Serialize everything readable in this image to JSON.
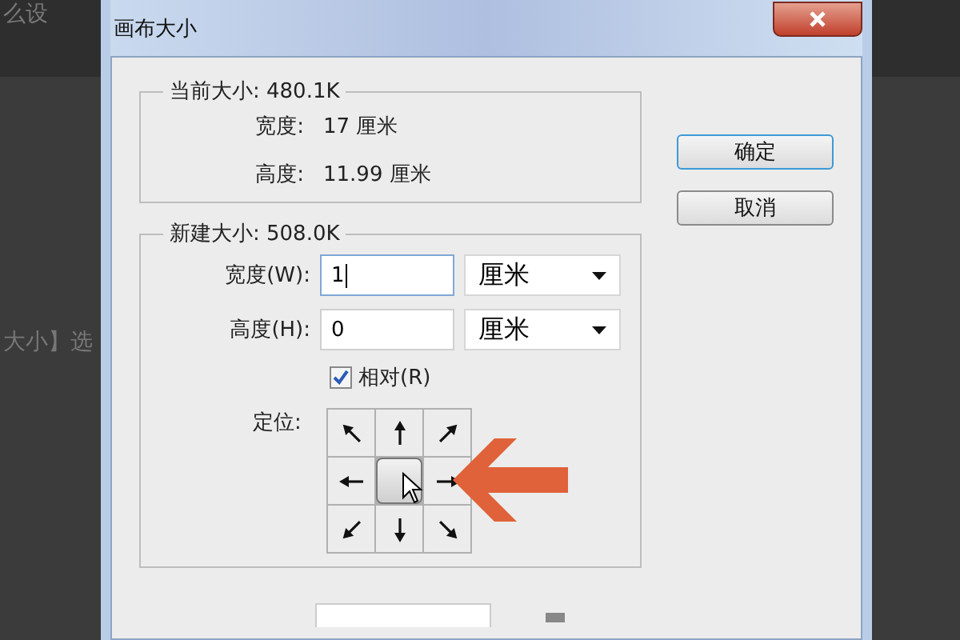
{
  "background": {
    "fragments": [
      "么设",
      "大小】选"
    ]
  },
  "dialog": {
    "title": "画布大小",
    "current_size": {
      "label": "当前大小: 480.1K",
      "rows": [
        {
          "label": "宽度:",
          "value": "17 厘米"
        },
        {
          "label": "高度:",
          "value": "11.99 厘米"
        }
      ]
    },
    "new_size": {
      "label": "新建大小: 508.0K",
      "fields": [
        {
          "label": "宽度(W):",
          "value": "1",
          "unit": "厘米",
          "focused": true
        },
        {
          "label": "高度(H):",
          "value": "0",
          "unit": "厘米",
          "focused": false
        }
      ],
      "relative": {
        "label": "相对(R)",
        "checked": true
      },
      "anchor": {
        "label": "定位:",
        "cells": [
          {
            "selected": false
          },
          {
            "selected": false
          },
          {
            "selected": false
          },
          {
            "selected": false
          },
          {
            "selected": true
          },
          {
            "selected": false
          },
          {
            "selected": false
          },
          {
            "selected": false
          },
          {
            "selected": false
          }
        ]
      }
    },
    "buttons": [
      {
        "label": "确定",
        "default": true
      },
      {
        "label": "取消",
        "default": false
      }
    ]
  }
}
